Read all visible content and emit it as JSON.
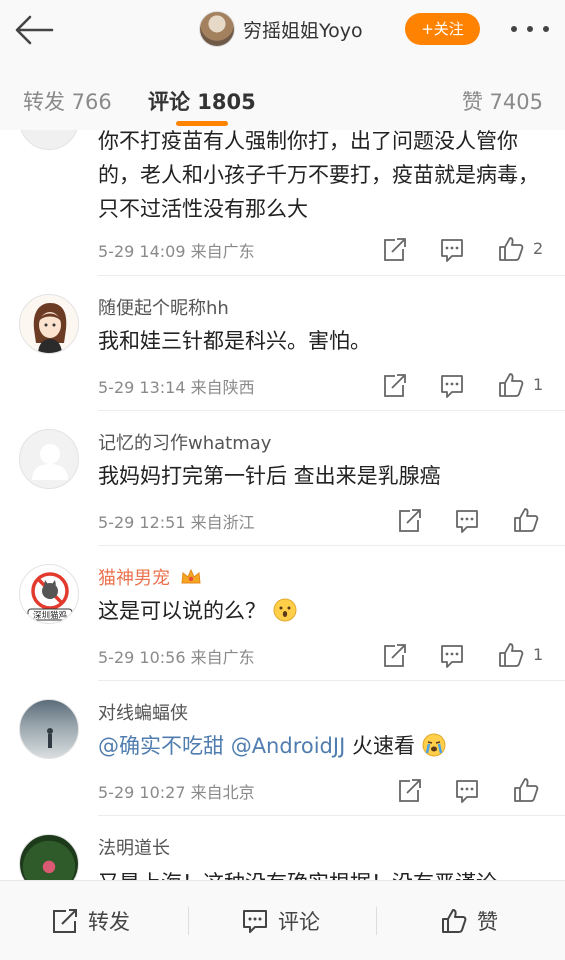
{
  "header": {
    "user_name": "穷摇姐姐Yoyo",
    "follow_label": "+关注"
  },
  "tabs": {
    "repost": "转发 766",
    "comment": "评论 1805",
    "like": "赞 7405"
  },
  "comments": [
    {
      "name": "",
      "text": "你不打疫苗有人强制你打，出了问题没人管你的，老人和小孩子千万不要打，疫苗就是病毒，只不过活性没有那么大",
      "meta": "5-29 14:09  来自广东",
      "likes": "2"
    },
    {
      "name": "随便起个昵称hh",
      "text": "我和娃三针都是科兴。害怕。",
      "meta": "5-29 13:14  来自陕西",
      "likes": "1"
    },
    {
      "name": "记忆的习作whatmay",
      "text": "我妈妈打完第一针后 查出来是乳腺癌",
      "meta": "5-29 12:51  来自浙江",
      "likes": ""
    },
    {
      "name": "猫神男宠",
      "text": "这是可以说的么？",
      "meta": "5-29 10:56  来自广东",
      "likes": "1",
      "avatar_text": "深圳猫鸡"
    },
    {
      "name": "对线蝙蝠侠",
      "mention1": "@确实不吃甜",
      "mention2": "@AndroidJJ",
      "text_tail": " 火速看",
      "meta": "5-29 10:27  来自北京",
      "likes": ""
    },
    {
      "name": "法明道长",
      "text": "又是上海！这种没有确实根据！没有严谨论"
    }
  ],
  "bottom_bar": {
    "repost": "转发",
    "comment": "评论",
    "like": "赞"
  },
  "colors": {
    "accent": "#ff8200",
    "mention": "#507daf",
    "vip_name": "#eb7350"
  }
}
